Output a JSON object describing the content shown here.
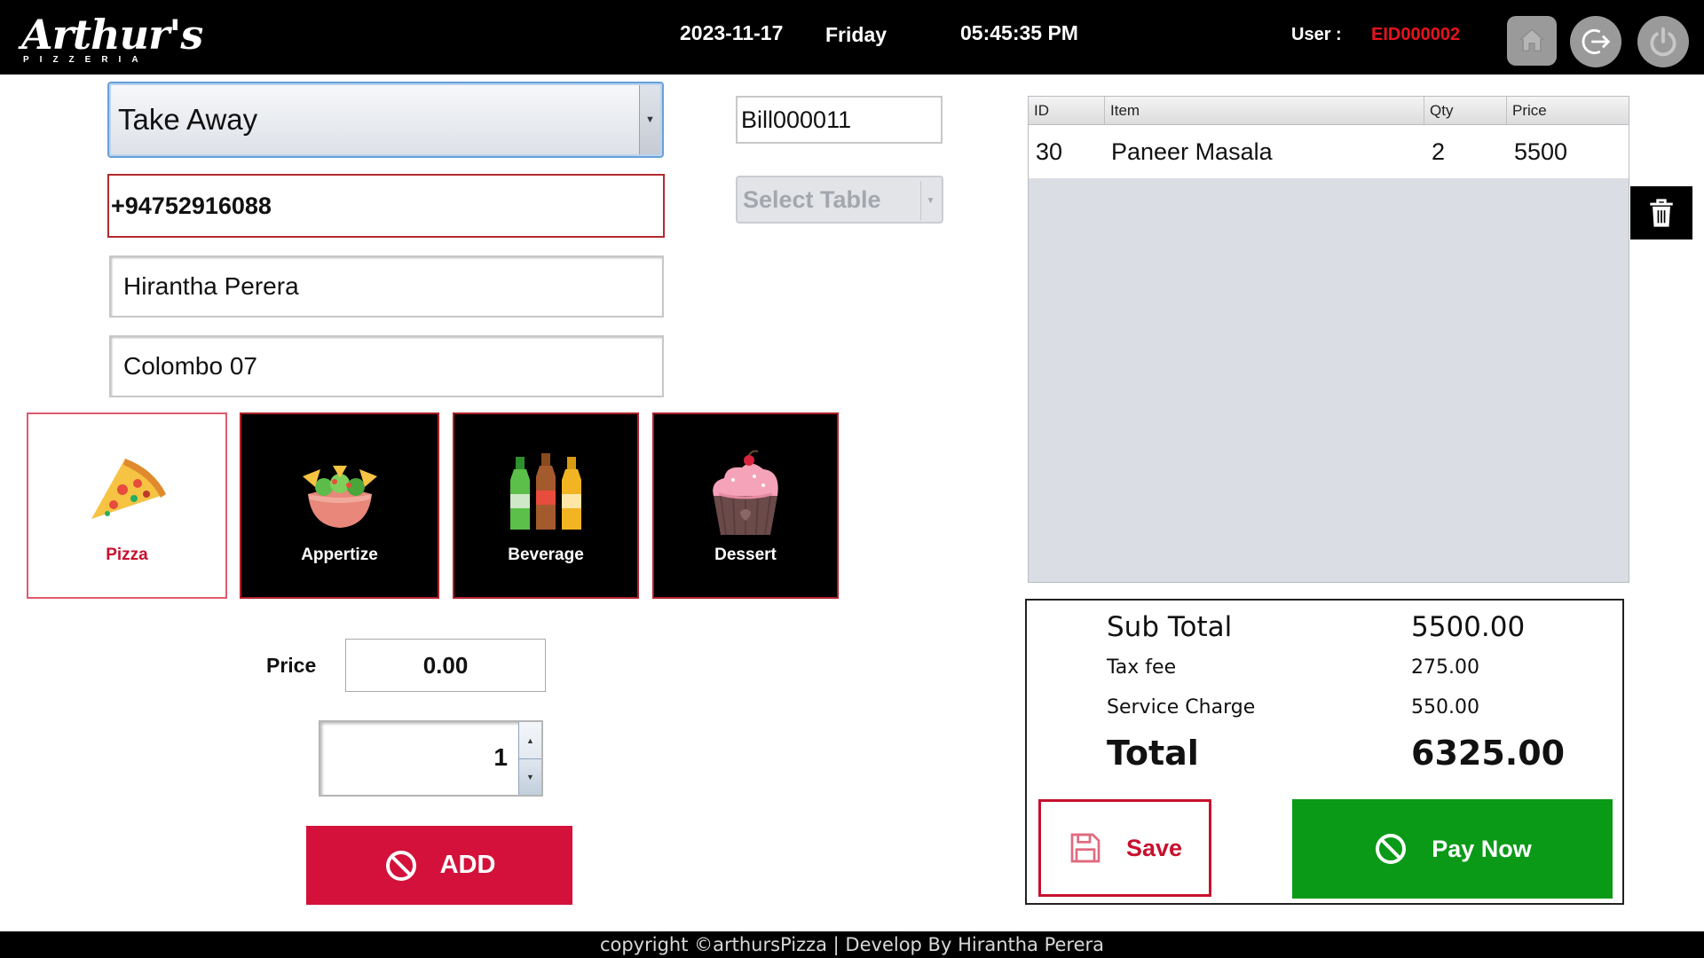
{
  "header": {
    "logo_text": "Arthur's",
    "logo_subtext": "PIZZERIA",
    "date": "2023-11-17",
    "day": "Friday",
    "time": "05:45:35 PM",
    "user_label": "User :",
    "user_id": "EID000002",
    "icons": [
      "home-icon",
      "logout-icon",
      "power-icon"
    ]
  },
  "order_form": {
    "order_type": "Take Away",
    "phone": "+94752916088",
    "customer_name": "Hirantha Perera",
    "address": "Colombo 07",
    "bill_no": "Bill000011",
    "table_select": "Select Table"
  },
  "categories": [
    {
      "label": "Pizza",
      "selected": true,
      "icon": "pizza-icon"
    },
    {
      "label": "Appertize",
      "selected": false,
      "icon": "salad-bowl-icon"
    },
    {
      "label": "Beverage",
      "selected": false,
      "icon": "bottles-icon"
    },
    {
      "label": "Dessert",
      "selected": false,
      "icon": "cupcake-icon"
    }
  ],
  "item_entry": {
    "price_label": "Price",
    "price_value": "0.00",
    "quantity": "1",
    "add_label": "ADD"
  },
  "order_table": {
    "columns": [
      "ID",
      "Item",
      "Qty",
      "Price"
    ],
    "rows": [
      {
        "id": "30",
        "item": "Paneer Masala",
        "qty": "2",
        "price": "5500"
      }
    ]
  },
  "totals": {
    "subtotal_label": "Sub Total",
    "subtotal_value": "5500.00",
    "tax_label": "Tax fee",
    "tax_value": "275.00",
    "service_label": "Service Charge",
    "service_value": "550.00",
    "total_label": "Total",
    "total_value": "6325.00",
    "save_label": "Save",
    "paynow_label": "Pay Now"
  },
  "footer": {
    "text": "copyright ©arthursPizza | Develop By Hirantha Perera"
  },
  "colors": {
    "accent_red": "#d4113a",
    "pay_green": "#0a9a18",
    "user_id_red": "#e8131b",
    "header_bg": "#000000"
  }
}
